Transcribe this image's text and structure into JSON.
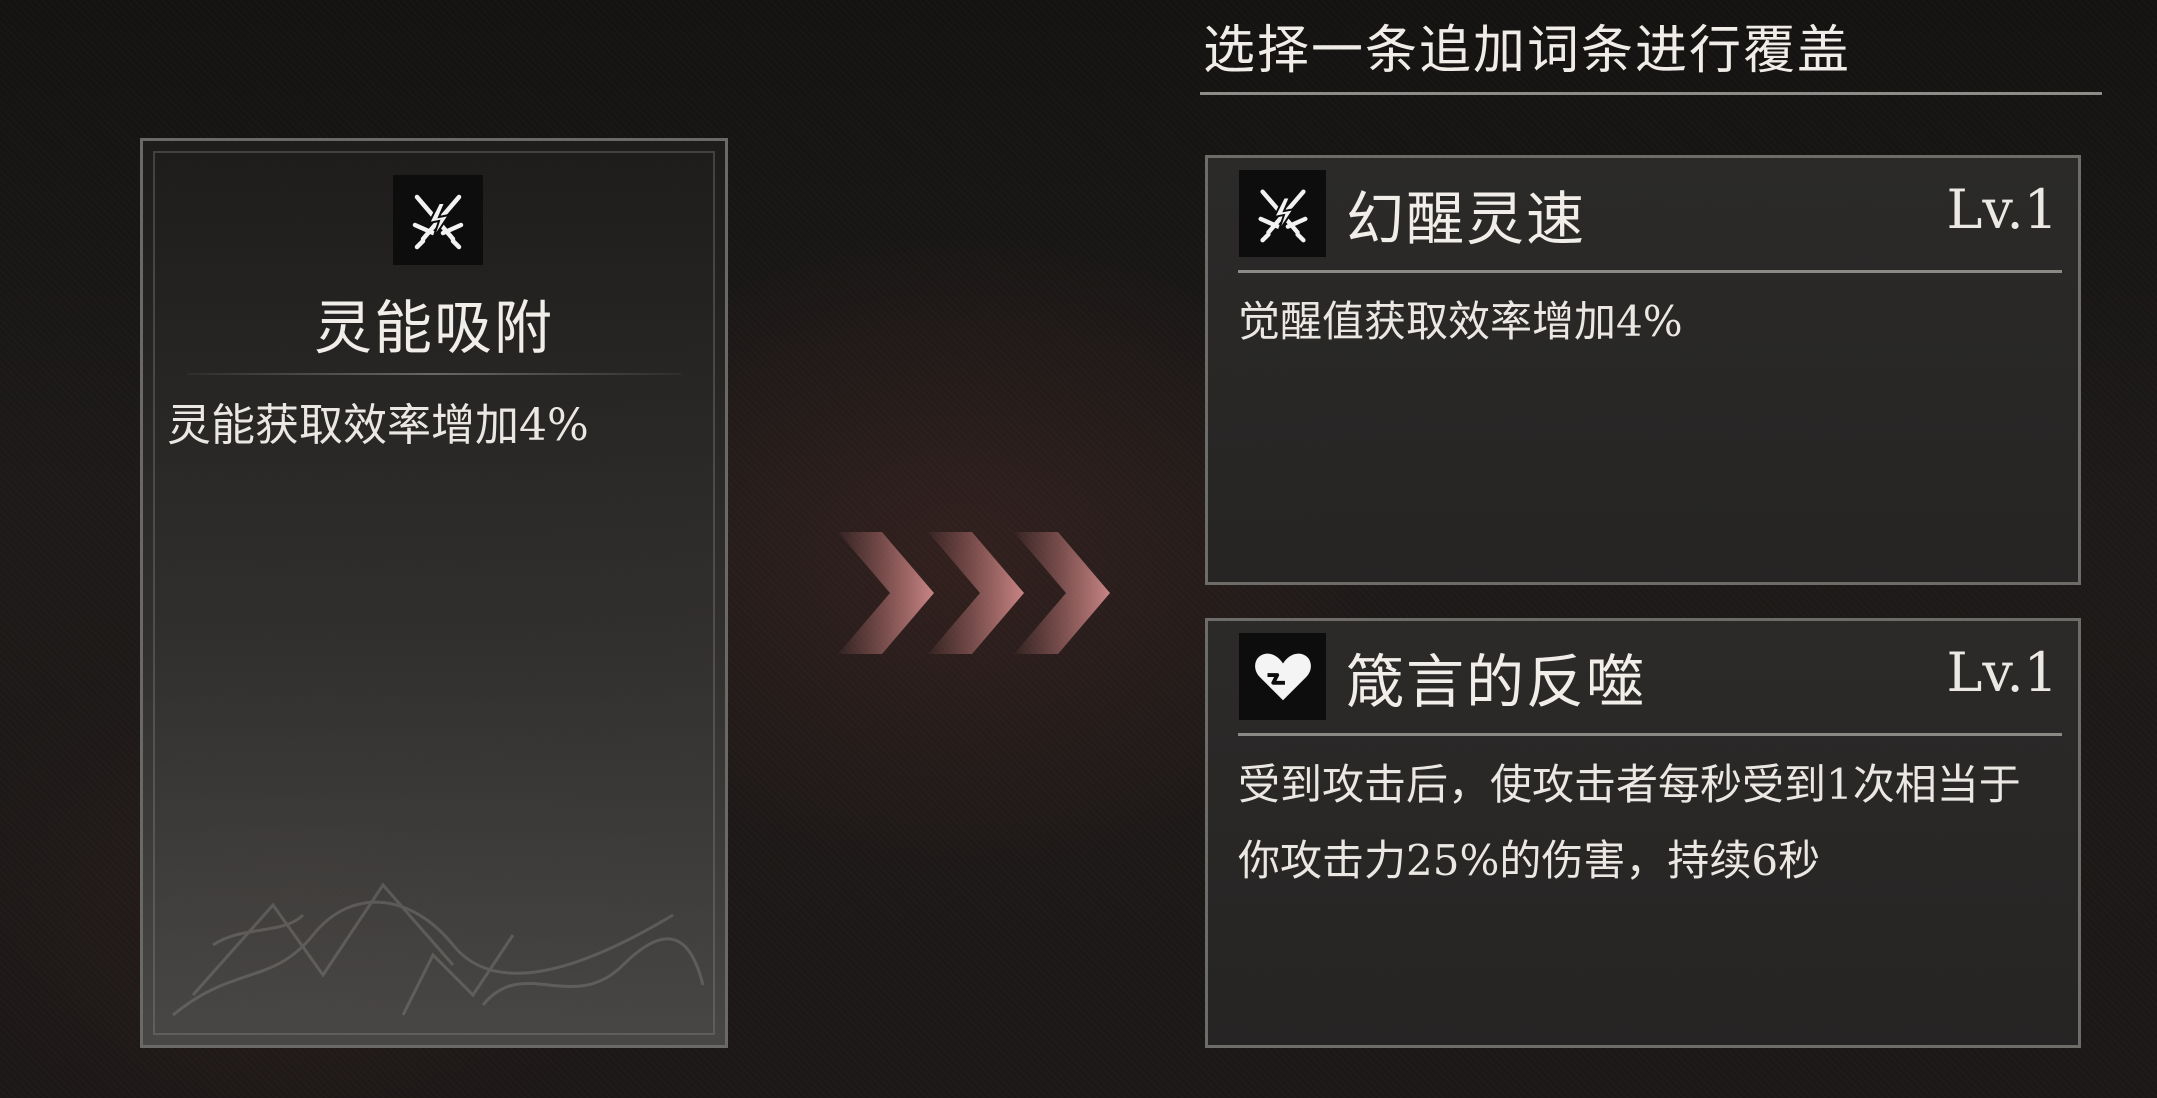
{
  "header": {
    "title": "选择一条追加词条进行覆盖"
  },
  "current_affix": {
    "icon": "crossed-swords-lightning-icon",
    "name": "灵能吸附",
    "description": "灵能获取效率增加4%"
  },
  "options": [
    {
      "icon": "crossed-swords-lightning-icon",
      "name": "幻醒灵速",
      "level": "Lv.1",
      "description": "觉醒值获取效率增加4%"
    },
    {
      "icon": "cracked-heart-icon",
      "name": "箴言的反噬",
      "level": "Lv.1",
      "description": "受到攻击后，使攻击者每秒受到1次相当于你攻击力25%的伤害，持续6秒"
    }
  ],
  "colors": {
    "arrow_accent": "#c97f7f",
    "panel_border": "#6e6c69",
    "background": "#1b1918"
  }
}
